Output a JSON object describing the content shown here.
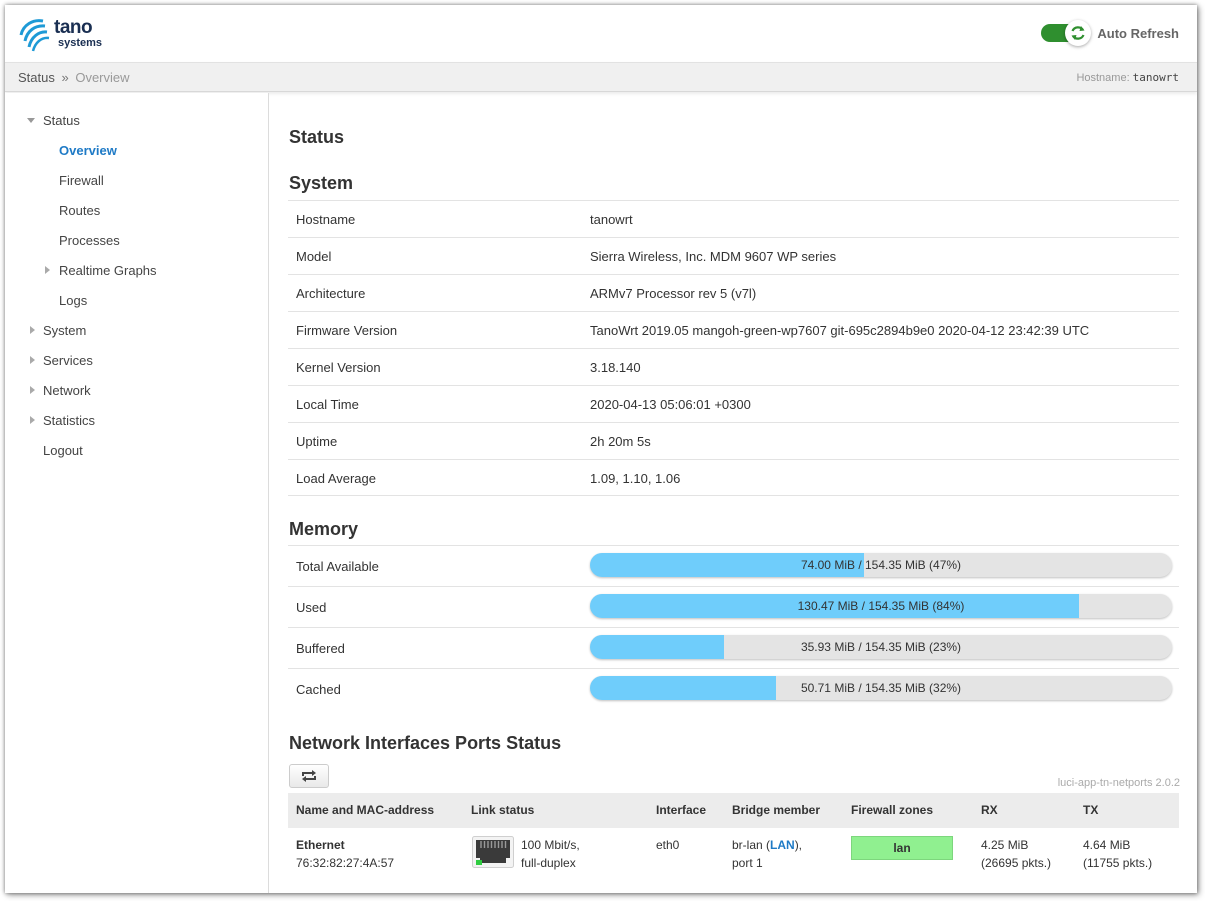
{
  "header": {
    "logo_line1": "tano",
    "logo_line2": "systems",
    "auto_refresh_label": "Auto Refresh",
    "auto_refresh_on": true
  },
  "breadcrumb": {
    "root": "Status",
    "separator": "»",
    "current": "Overview",
    "hostname_label": "Hostname:",
    "hostname_value": "tanowrt"
  },
  "sidebar": {
    "items": [
      {
        "label": "Status",
        "expanded": true
      },
      {
        "label": "Overview",
        "active": true
      },
      {
        "label": "Firewall"
      },
      {
        "label": "Routes"
      },
      {
        "label": "Processes"
      },
      {
        "label": "Realtime Graphs",
        "expandable": true
      },
      {
        "label": "Logs"
      },
      {
        "label": "System",
        "expandable": true
      },
      {
        "label": "Services",
        "expandable": true
      },
      {
        "label": "Network",
        "expandable": true
      },
      {
        "label": "Statistics",
        "expandable": true
      },
      {
        "label": "Logout"
      }
    ]
  },
  "main": {
    "title": "Status",
    "system": {
      "title": "System",
      "rows": [
        {
          "key": "Hostname",
          "value": "tanowrt"
        },
        {
          "key": "Model",
          "value": "Sierra Wireless, Inc. MDM 9607 WP series"
        },
        {
          "key": "Architecture",
          "value": "ARMv7 Processor rev 5 (v7l)"
        },
        {
          "key": "Firmware Version",
          "value": "TanoWrt 2019.05 mangoh-green-wp7607 git-695c2894b9e0 2020-04-12 23:42:39 UTC"
        },
        {
          "key": "Kernel Version",
          "value": "3.18.140"
        },
        {
          "key": "Local Time",
          "value": "2020-04-13 05:06:01 +0300"
        },
        {
          "key": "Uptime",
          "value": "2h 20m 5s"
        },
        {
          "key": "Load Average",
          "value": "1.09, 1.10, 1.06"
        }
      ]
    },
    "memory": {
      "title": "Memory",
      "rows": [
        {
          "key": "Total Available",
          "text": "74.00 MiB / 154.35 MiB (47%)",
          "percent": 47
        },
        {
          "key": "Used",
          "text": "130.47 MiB / 154.35 MiB (84%)",
          "percent": 84
        },
        {
          "key": "Buffered",
          "text": "35.93 MiB / 154.35 MiB (23%)",
          "percent": 23
        },
        {
          "key": "Cached",
          "text": "50.71 MiB / 154.35 MiB (32%)",
          "percent": 32
        }
      ]
    },
    "ports": {
      "title": "Network Interfaces Ports Status",
      "version": "luci-app-tn-netports 2.0.2",
      "columns": [
        "Name and MAC-address",
        "Link status",
        "Interface",
        "Bridge member",
        "Firewall zones",
        "RX",
        "TX"
      ],
      "rows": [
        {
          "name": "Ethernet",
          "mac": "76:32:82:27:4A:57",
          "link_line1": "100 Mbit/s,",
          "link_line2": "full-duplex",
          "interface": "eth0",
          "bridge_prefix": "br-lan (",
          "bridge_link": "LAN",
          "bridge_suffix": "),",
          "bridge_port": "port 1",
          "zone": "lan",
          "zone_color": "#90f090",
          "rx_line1": "4.25 MiB",
          "rx_line2": "(26695 pkts.)",
          "tx_line1": "4.64 MiB",
          "tx_line2": "(11755 pkts.)"
        }
      ]
    }
  },
  "colors": {
    "accent": "#1e7ac6",
    "bar_fill": "#6fcdfb",
    "toggle_on": "#2f8f2f"
  }
}
